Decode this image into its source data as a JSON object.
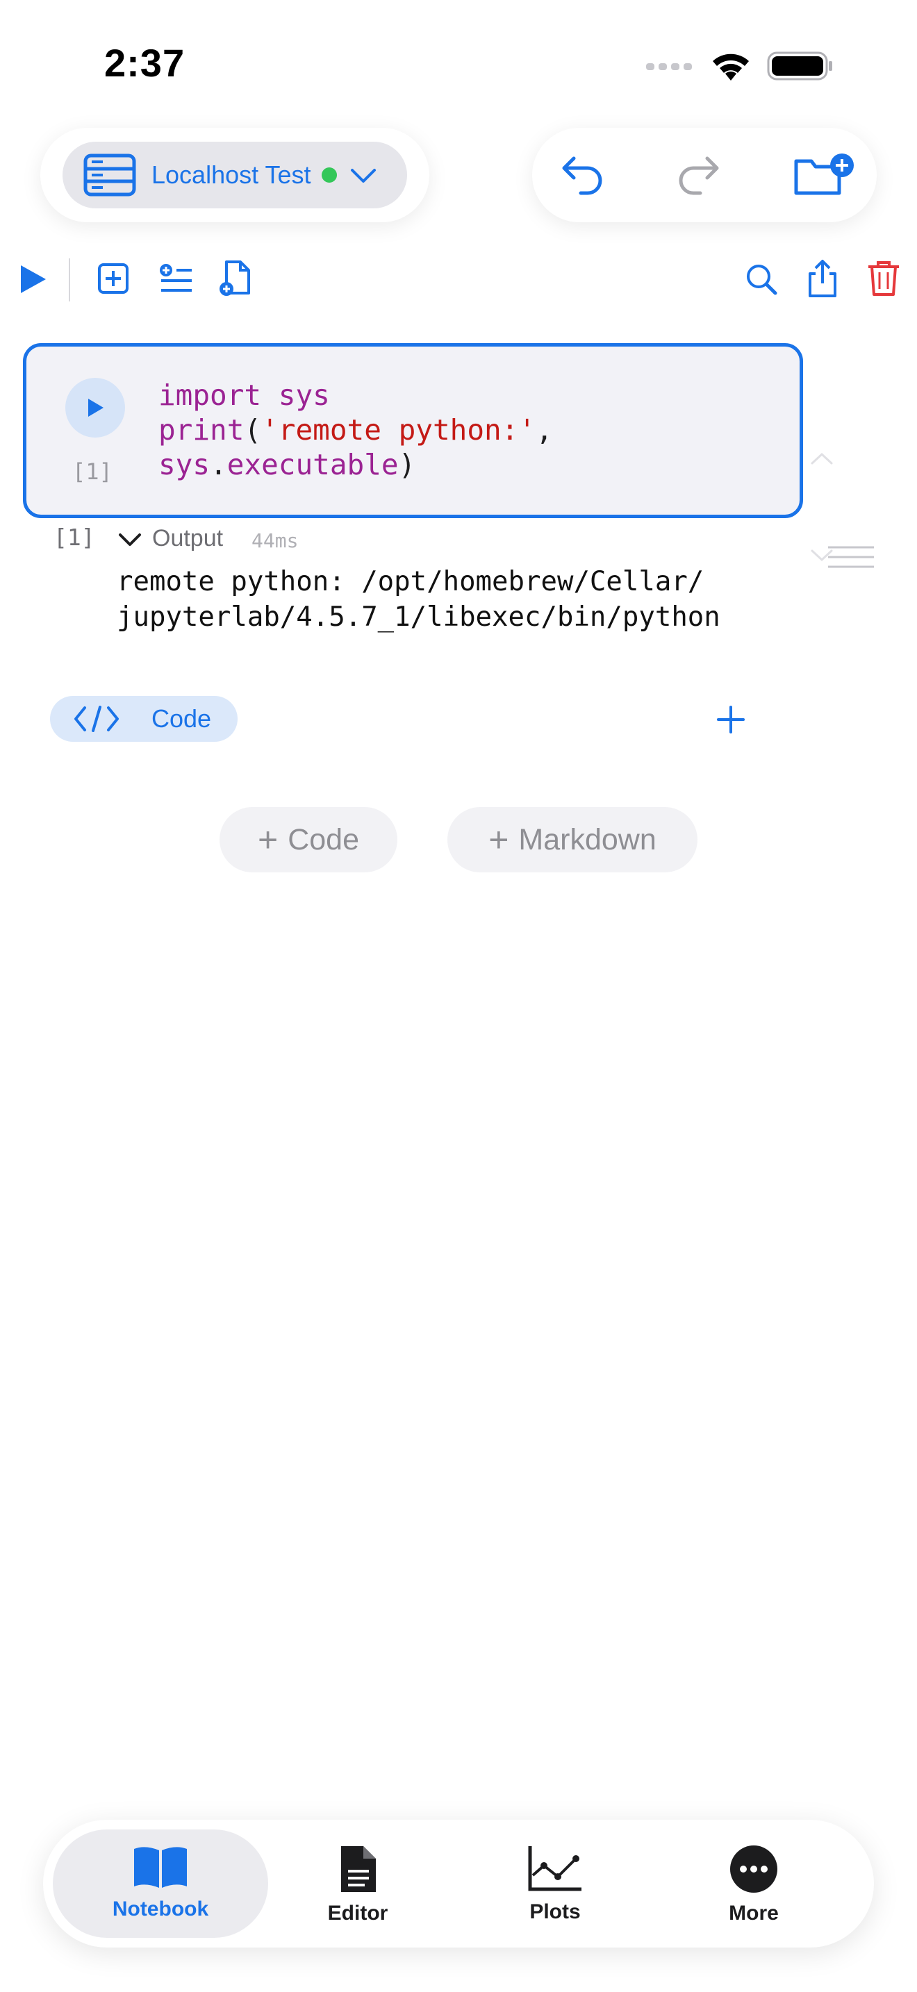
{
  "status_bar": {
    "time": "2:37"
  },
  "server": {
    "name": "Localhost Test",
    "status_color": "#34c759"
  },
  "cell": {
    "execution_count": "[1]",
    "code_line1_kw": "import",
    "code_line1_rest": " sys",
    "code_line2_fn": "print",
    "code_line2_open": "(",
    "code_line2_str": "'remote python:'",
    "code_line2_end": ",",
    "code_line3_obj": "sys",
    "code_line3_dot": ".",
    "code_line3_attr": "executable",
    "code_line3_close": ")"
  },
  "output": {
    "count": "[1]",
    "label": "Output",
    "duration": "44ms",
    "text_line1": "remote python: /opt/homebrew/Cellar/",
    "text_line2": "jupyterlab/4.5.7_1/libexec/bin/python"
  },
  "cell_type": {
    "label": "Code"
  },
  "add_buttons": {
    "code": "Code",
    "markdown": "Markdown"
  },
  "tabs": [
    {
      "label": "Notebook",
      "icon": "book-icon",
      "active": true
    },
    {
      "label": "Editor",
      "icon": "document-icon",
      "active": false
    },
    {
      "label": "Plots",
      "icon": "chart-line-icon",
      "active": false
    },
    {
      "label": "More",
      "icon": "ellipsis-circle-icon",
      "active": false
    }
  ],
  "colors": {
    "accent": "#1a73e8",
    "danger": "#e5383b",
    "keyword": "#9b2393",
    "string": "#c41a16"
  }
}
